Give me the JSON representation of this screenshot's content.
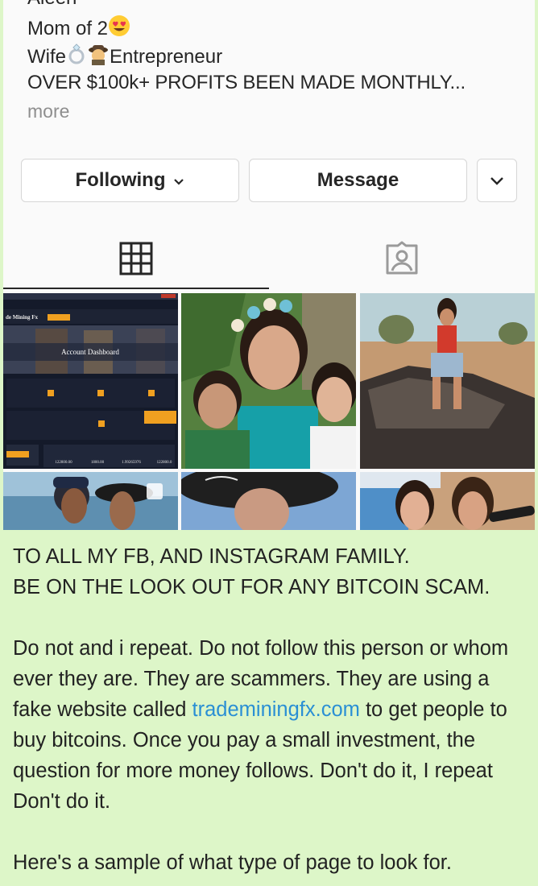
{
  "profile": {
    "name": "Aleen",
    "bio_line1": "Mom of 2",
    "bio_line2_a": "Wife",
    "bio_line2_b": "Entrepreneur",
    "bio_line3": "OVER $100k+ PROFITS BEEN MADE MONTHLY...",
    "more_label": "more"
  },
  "buttons": {
    "following_label": "Following",
    "message_label": "Message"
  },
  "tabs": [
    "grid-icon",
    "tagged-icon"
  ],
  "posts": {
    "dashboard_title": "Account Dashboard",
    "dashboard_logo": "de Mining Fx",
    "dashboard_balances": [
      "122800.00",
      "1800.00",
      "1.99265976",
      "122800.0"
    ]
  },
  "warning": {
    "line1": "TO ALL MY FB, AND INSTAGRAM FAMILY.",
    "line2": "BE ON THE LOOK OUT FOR ANY BITCOIN SCAM.",
    "para2_a": "Do not and i repeat. Do not follow this person or whom ever they are. They are scammers. They are using a fake website called ",
    "link": "trademiningfx.com",
    "para2_b": " to get people to buy bitcoins. Once you pay a small investment, the question for more money follows. Don't do it, I repeat Don't do it.",
    "para3": "Here's a sample of what type of page to look for."
  },
  "colors": {
    "page_bg": "#ddf6c8",
    "card_bg": "#fafafa",
    "link": "#2a8fd4"
  }
}
